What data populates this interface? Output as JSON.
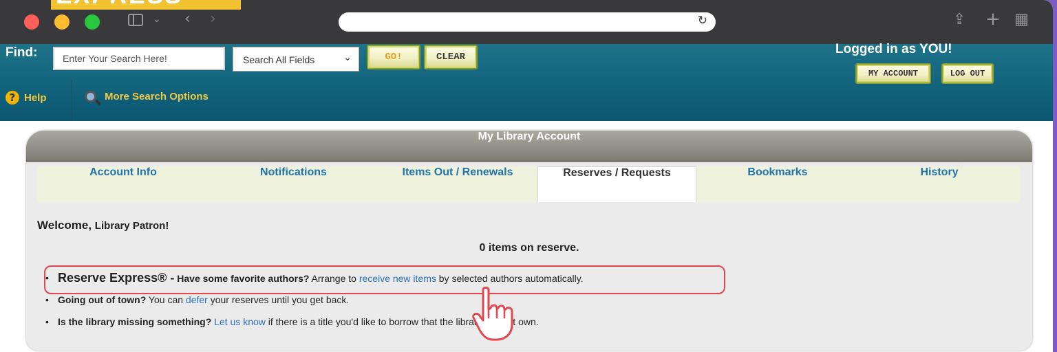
{
  "banner": {
    "text": "EXPRESS"
  },
  "browser": {
    "controls": [
      "close",
      "minimize",
      "zoom"
    ],
    "icons": [
      "sidebar-icon",
      "back-icon",
      "forward-icon",
      "reload-icon",
      "share-icon",
      "new-tab-icon",
      "tab-overview-icon"
    ]
  },
  "header": {
    "find_label": "Find:",
    "search_placeholder": "Enter Your Search Here!",
    "search_field": "Search All Fields",
    "go_label": "GO!",
    "clear_label": "CLEAR",
    "logged_in": "Logged in as YOU!",
    "my_account_label": "MY ACCOUNT",
    "logout_label": "LOG OUT",
    "help_label": "Help",
    "more_search_label": "More Search Options"
  },
  "panel": {
    "title": "My Library Account",
    "tabs": [
      {
        "label": "Account Info"
      },
      {
        "label": "Notifications"
      },
      {
        "label": "Items Out / Renewals"
      },
      {
        "label": "Reserves / Requests",
        "active": true
      },
      {
        "label": "Bookmarks"
      },
      {
        "label": "History"
      }
    ],
    "welcome_prefix": "Welcome,",
    "welcome_name": "Library Patron!",
    "reserve_count": "0 items on reserve.",
    "tips": [
      {
        "lead": "Reserve Express® -",
        "bold_question": "Have some favorite authors?",
        "pre": " Arrange to ",
        "link": "receive new items",
        "post": " by selected authors automatically."
      },
      {
        "lead": "Going out of town?",
        "pre": " You can ",
        "link": "defer",
        "post": " your reserves until you get back."
      },
      {
        "lead": "Is the library missing something?",
        "pre": " ",
        "link": "Let us know",
        "post": " if there is a title you'd like to borrow that the library doesn't own."
      }
    ]
  },
  "colors": {
    "header": "#0f5f78",
    "link": "#2a6fb8",
    "accent_yellow": "#f3c73e",
    "highlight": "#e2474f",
    "frame": "#7b5cc4"
  }
}
